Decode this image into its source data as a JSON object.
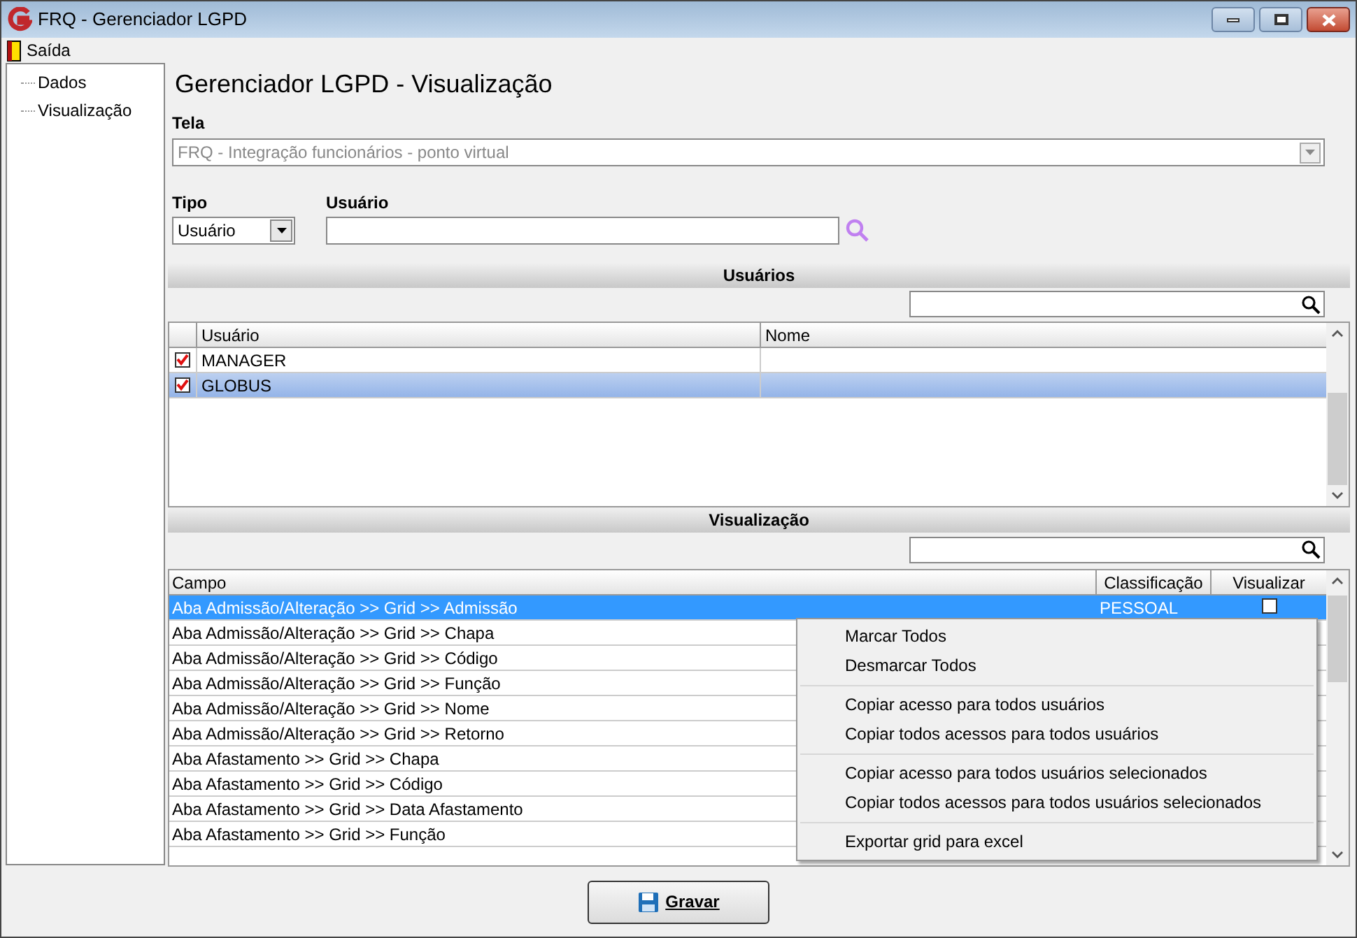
{
  "window": {
    "title": "FRQ - Gerenciador LGPD"
  },
  "menu": [
    {
      "label": "Saída"
    }
  ],
  "tree": [
    {
      "label": "Dados",
      "selected": false
    },
    {
      "label": "Visualização",
      "selected": false
    }
  ],
  "page_title": "Gerenciador LGPD - Visualização",
  "tela": {
    "label": "Tela",
    "value": "FRQ - Integração funcionários - ponto virtual",
    "disabled": true
  },
  "tipo": {
    "label": "Tipo",
    "value": "Usuário"
  },
  "usuario": {
    "label": "Usuário"
  },
  "users_section": {
    "title": "Usuários",
    "columns": [
      "Usuário",
      "Nome"
    ],
    "rows": [
      {
        "usuario": "MANAGER",
        "checked": true,
        "selected": false
      },
      {
        "usuario": "GLOBUS",
        "checked": true,
        "selected": true
      }
    ]
  },
  "view_section": {
    "title": "Visualização",
    "columns": [
      "Campo",
      "Classificação",
      "Visualizar"
    ],
    "rows": [
      {
        "campo": "Aba Admissão/Alteração >> Grid >> Admissão",
        "classificacao": "PESSOAL",
        "visualizar": false,
        "selected": true
      },
      {
        "campo": "Aba Admissão/Alteração >> Grid >> Chapa",
        "selected": false
      },
      {
        "campo": "Aba Admissão/Alteração >> Grid >> Código",
        "selected": false
      },
      {
        "campo": "Aba Admissão/Alteração >> Grid >> Função",
        "selected": false
      },
      {
        "campo": "Aba Admissão/Alteração >> Grid >> Nome",
        "selected": false
      },
      {
        "campo": "Aba Admissão/Alteração >> Grid >> Retorno",
        "selected": false
      },
      {
        "campo": "Aba Afastamento >> Grid >> Chapa",
        "selected": false
      },
      {
        "campo": "Aba Afastamento >> Grid >> Código",
        "selected": false
      },
      {
        "campo": "Aba Afastamento >> Grid >> Data Afastamento",
        "selected": false
      },
      {
        "campo": "Aba Afastamento >> Grid >> Função",
        "selected": false
      }
    ]
  },
  "context_menu": [
    [
      {
        "label": "Marcar Todos"
      },
      {
        "label": "Desmarcar Todos"
      }
    ],
    [
      {
        "label": "Copiar acesso para todos usuários"
      },
      {
        "label": "Copiar todos acessos para todos usuários"
      }
    ],
    [
      {
        "label": "Copiar acesso para todos usuários selecionados"
      },
      {
        "label": "Copiar todos acessos para todos usuários selecionados"
      }
    ],
    [
      {
        "label": "Exportar grid para excel"
      }
    ]
  ],
  "save_button": {
    "label": "Gravar"
  }
}
